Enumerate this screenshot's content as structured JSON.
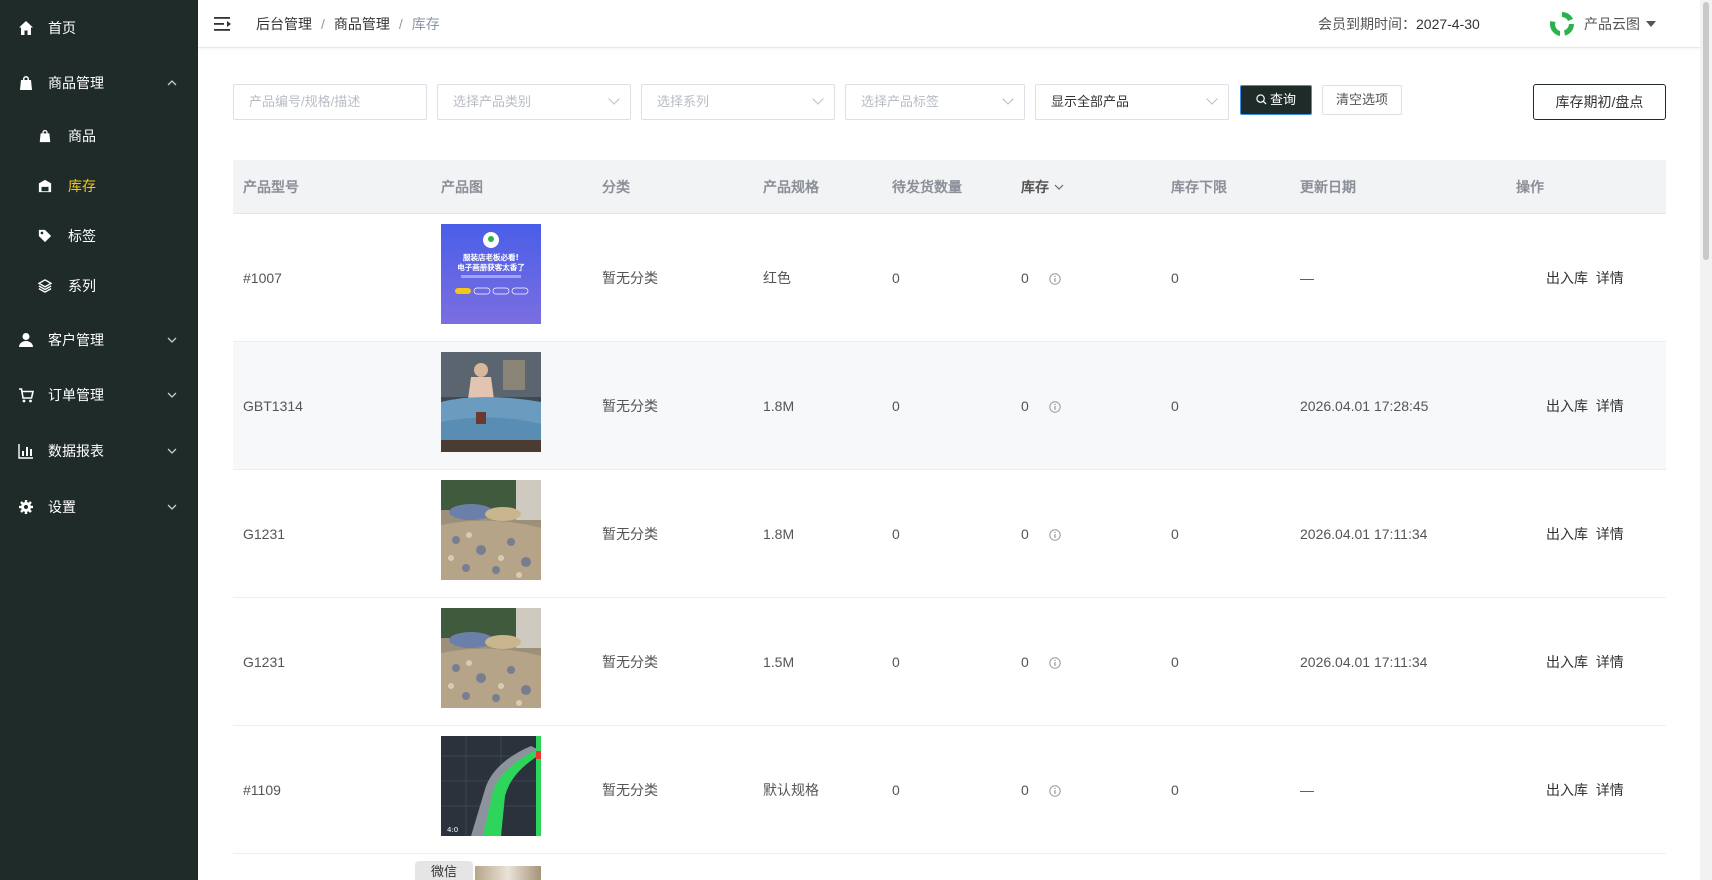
{
  "sidebar": {
    "home": "首页",
    "product_mgmt": "商品管理",
    "sub_products": "商品",
    "sub_inventory": "库存",
    "sub_tags": "标签",
    "sub_series": "系列",
    "customer_mgmt": "客户管理",
    "order_mgmt": "订单管理",
    "reports": "数据报表",
    "settings": "设置"
  },
  "header": {
    "breadcrumb": [
      "后台管理",
      "商品管理",
      "库存"
    ],
    "member_label": "会员到期时间：",
    "member_date": "2027-4-30",
    "brand": "产品云图"
  },
  "filters": {
    "search_placeholder": "产品编号/规格/描述",
    "category_placeholder": "选择产品类别",
    "series_placeholder": "选择系列",
    "tag_placeholder": "选择产品标签",
    "display_value": "显示全部产品",
    "query_label": "查询",
    "clear_label": "清空选项",
    "inventory_button": "库存期初/盘点"
  },
  "table": {
    "columns": [
      "产品型号",
      "产品图",
      "分类",
      "产品规格",
      "待发货数量",
      "库存",
      "库存下限",
      "更新日期",
      "操作"
    ],
    "rows": [
      {
        "model": "#1007",
        "category": "暂无分类",
        "spec": "红色",
        "pending": "0",
        "stock": "0",
        "min": "0",
        "updated": "—",
        "image": "promo-banner",
        "action_inout": "出入库",
        "action_detail": "详情"
      },
      {
        "model": "GBT1314",
        "category": "暂无分类",
        "spec": "1.8M",
        "pending": "0",
        "stock": "0",
        "min": "0",
        "updated": "2026.04.01 17:28:45",
        "image": "bedding-blue",
        "action_inout": "出入库",
        "action_detail": "详情"
      },
      {
        "model": "G1231",
        "category": "暂无分类",
        "spec": "1.8M",
        "pending": "0",
        "stock": "0",
        "min": "0",
        "updated": "2026.04.01 17:11:34",
        "image": "bedding-floral",
        "action_inout": "出入库",
        "action_detail": "详情"
      },
      {
        "model": "G1231",
        "category": "暂无分类",
        "spec": "1.5M",
        "pending": "0",
        "stock": "0",
        "min": "0",
        "updated": "2026.04.01 17:11:34",
        "image": "bedding-floral",
        "action_inout": "出入库",
        "action_detail": "详情"
      },
      {
        "model": "#1109",
        "category": "暂无分类",
        "spec": "默认规格",
        "pending": "0",
        "stock": "0",
        "min": "0",
        "updated": "—",
        "image": "navigation-map",
        "action_inout": "出入库",
        "action_detail": "详情"
      }
    ]
  },
  "promo_image": {
    "line1": "服装店老板必看!",
    "line2": "电子画册获客太香了"
  },
  "floating": {
    "wechat": "微信"
  },
  "colors": {
    "sidebar_bg": "#1f2b28",
    "active_accent": "#f5c518",
    "brand_green": "#2bb24c"
  }
}
